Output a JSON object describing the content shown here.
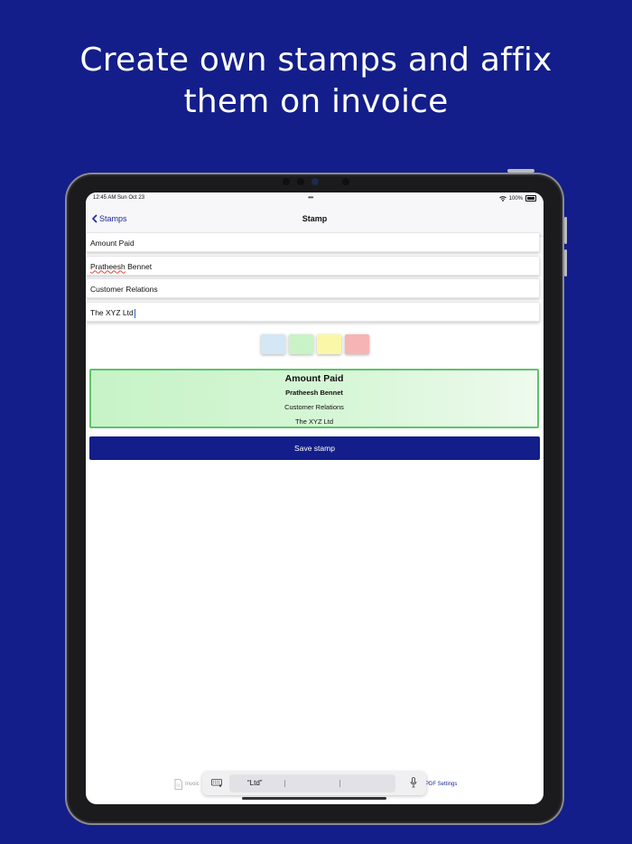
{
  "headline": {
    "line1": "Create own stamps and affix",
    "line2": "them on invoice"
  },
  "status_bar": {
    "time": "12:45 AM  Sun Oct 23",
    "battery": "100%"
  },
  "nav": {
    "back_label": "Stamps",
    "title": "Stamp"
  },
  "fields": [
    {
      "value": "Amount Paid"
    },
    {
      "value_first": "Pratheesh",
      "value_rest": " Bennet"
    },
    {
      "value": "Customer Relations"
    },
    {
      "value": "The XYZ Ltd"
    }
  ],
  "swatches": [
    {
      "name": "blue",
      "color": "#d4e7f5"
    },
    {
      "name": "green",
      "color": "#c9f3c6"
    },
    {
      "name": "yellow",
      "color": "#fbf7a8"
    },
    {
      "name": "red",
      "color": "#f7b4b4"
    }
  ],
  "stamp_preview": {
    "line1": "Amount Paid",
    "line2": "Pratheesh Bennet",
    "line3": "Customer Relations",
    "line4": "The XYZ Ltd",
    "border_color": "#5cc46b"
  },
  "save_button": "Save stamp",
  "tabs": {
    "invoice_label": "Invoic",
    "pdf_settings_label": "PDF Settings"
  },
  "keyboard_bar": {
    "suggestion": "“Ltd”"
  },
  "colors": {
    "brand": "#131e8a",
    "link": "#1a2a9a"
  }
}
